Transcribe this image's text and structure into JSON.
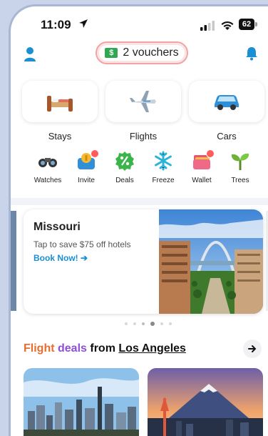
{
  "status_bar": {
    "time": "11:09",
    "battery": "62"
  },
  "header": {
    "vouchers_count_label": "$",
    "vouchers_label": "2 vouchers"
  },
  "categories": [
    {
      "label": "Stays",
      "icon": "bed-icon"
    },
    {
      "label": "Flights",
      "icon": "airplane-icon"
    },
    {
      "label": "Cars",
      "icon": "car-icon"
    }
  ],
  "tools": [
    {
      "label": "Watches",
      "icon": "binoculars-icon"
    },
    {
      "label": "Invite",
      "icon": "invite-coin-icon"
    },
    {
      "label": "Deals",
      "icon": "percent-badge-icon"
    },
    {
      "label": "Freeze",
      "icon": "snowflake-icon"
    },
    {
      "label": "Wallet",
      "icon": "wallet-icon"
    },
    {
      "label": "Trees",
      "icon": "sprout-icon"
    }
  ],
  "promo": {
    "title": "Missouri",
    "subtitle": "Tap to save $75 off hotels",
    "cta": "Book Now! ➔"
  },
  "carousel": {
    "pages": 6,
    "active_index": 3
  },
  "deals_section": {
    "word1": "Flight",
    "word2": "deals",
    "word3": "from",
    "city": "Los Angeles"
  },
  "colors": {
    "accent_blue": "#1a8fd1",
    "voucher_green": "#2fa84f",
    "alert_red": "#ff5c5c"
  }
}
